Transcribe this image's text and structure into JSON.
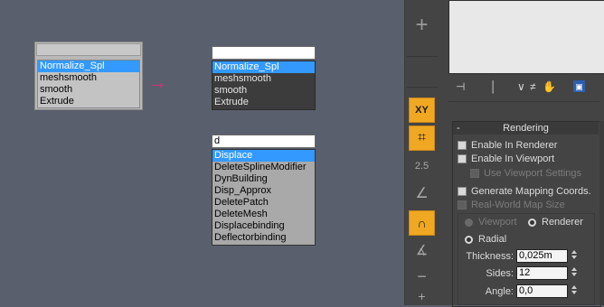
{
  "popup1": {
    "input_value": "",
    "items": [
      "Normalize_Spl",
      "meshsmooth",
      "smooth",
      "Extrude"
    ],
    "selected_index": 0
  },
  "arrow": {
    "glyph": "→",
    "color": "#d4307a"
  },
  "popup2": {
    "input_value": "",
    "items": [
      "Normalize_Spl",
      "meshsmooth",
      "smooth",
      "Extrude"
    ],
    "selected_index": 0
  },
  "popup3": {
    "input_value": "d",
    "items": [
      "Displace",
      "DeleteSplineModifier",
      "DynBuilding",
      "Disp_Approx",
      "DeletePatch",
      "DeleteMesh",
      "Displacebinding",
      "Deflectorbinding"
    ],
    "selected_index": 0
  },
  "toolbar": {
    "buttons": [
      {
        "icon": "plus-icon",
        "label": "+"
      },
      {
        "icon": "xy-lock-icon",
        "label": "XY"
      },
      {
        "icon": "pin-icon",
        "label": "⌗"
      },
      {
        "icon": "snap-2-5-icon",
        "label": "2.5"
      },
      {
        "icon": "angle-snap-icon",
        "label": "∠"
      },
      {
        "icon": "percent-snap-icon",
        "label": "∩"
      },
      {
        "icon": "spinner-snap-icon",
        "label": "∡"
      },
      {
        "icon": "edit-named-selection-icon",
        "label": "−"
      },
      {
        "icon": "small-plus-icon",
        "label": "+"
      }
    ],
    "accent": "#f0a823"
  },
  "rendering": {
    "title": "Rendering",
    "collapse_symbol": "-",
    "enable_in_renderer": "Enable In Renderer",
    "enable_in_viewport": "Enable In Viewport",
    "use_viewport_settings": "Use Viewport Settings",
    "generate_mapping_coords": "Generate Mapping Coords.",
    "real_world_map_size": "Real-World Map Size",
    "viewport_radio": "Viewport",
    "renderer_radio": "Renderer",
    "radial_radio": "Radial",
    "thickness_label": "Thickness:",
    "thickness_value": "0,025m",
    "sides_label": "Sides:",
    "sides_value": "12",
    "angle_label": "Angle:",
    "angle_value": "0,0"
  }
}
